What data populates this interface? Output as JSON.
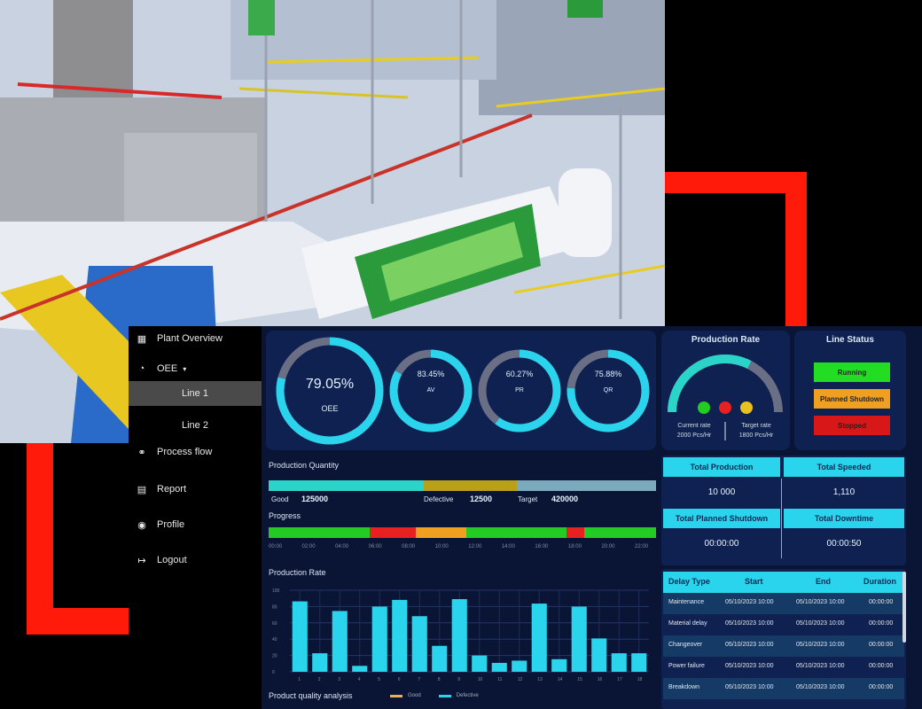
{
  "sidebar": {
    "items": [
      {
        "label": "Plant Overview",
        "icon": "factory-icon"
      },
      {
        "label": "OEE",
        "icon": "gauge-icon"
      },
      {
        "label": "Line 1"
      },
      {
        "label": "Line 2"
      },
      {
        "label": "Process flow",
        "icon": "flow-icon"
      },
      {
        "label": "Report",
        "icon": "report-icon"
      },
      {
        "label": "Profile",
        "icon": "profile-icon"
      },
      {
        "label": "Logout",
        "icon": "logout-icon"
      }
    ],
    "active": "Line 1"
  },
  "oee": {
    "main": {
      "value": "79.05%",
      "label": "OEE",
      "fraction": 0.79
    },
    "gauges": [
      {
        "value": "83.45%",
        "label": "AV",
        "fraction": 0.83
      },
      {
        "value": "60.27%",
        "label": "PR",
        "fraction": 0.6
      },
      {
        "value": "75.88%",
        "label": "QR",
        "fraction": 0.76
      }
    ]
  },
  "production_rate_card": {
    "title": "Production Rate",
    "current_label": "Current rate",
    "current_value": "2000 Pcs/Hr",
    "target_label": "Target rate",
    "target_value": "1800 Pcs/Hr",
    "level": 0.65,
    "lights": [
      "#22cc22",
      "#e82020",
      "#e8c020"
    ]
  },
  "line_status": {
    "title": "Line Status",
    "buttons": [
      {
        "label": "Running",
        "color": "#22dd22"
      },
      {
        "label": "Planned Shutdown",
        "color": "#f0a020"
      },
      {
        "label": "Stopped",
        "color": "#d81818"
      }
    ]
  },
  "production_quantity": {
    "title": "Production Quantity",
    "good_label": "Good",
    "good_value": "125000",
    "defective_label": "Defective",
    "defective_value": "12500",
    "target_label": "Target",
    "target_value": "420000",
    "segments": [
      {
        "fraction": 0.4,
        "color": "#2ad4c8"
      },
      {
        "fraction": 0.24,
        "color": "#b8a018"
      },
      {
        "fraction": 0.36,
        "color": "#7aaabb"
      }
    ]
  },
  "progress": {
    "title": "Progress",
    "segments": [
      {
        "fraction": 0.26,
        "color": "#22cc22"
      },
      {
        "fraction": 0.12,
        "color": "#e82020"
      },
      {
        "fraction": 0.13,
        "color": "#f0a020"
      },
      {
        "fraction": 0.26,
        "color": "#22cc22"
      },
      {
        "fraction": 0.045,
        "color": "#e82020"
      },
      {
        "fraction": 0.185,
        "color": "#22cc22"
      }
    ],
    "ticks": [
      "00:00",
      "02:00",
      "04:00",
      "06:00",
      "08:00",
      "10:00",
      "12:00",
      "14:00",
      "16:00",
      "18:00",
      "20:00",
      "22:00"
    ]
  },
  "kpis": [
    {
      "label": "Total Production",
      "value": "10 000"
    },
    {
      "label": "Total Speeded",
      "value": "1,110"
    },
    {
      "label": "Total Planned Shutdown",
      "value": "00:00:00"
    },
    {
      "label": "Total Downtime",
      "value": "00:00:50"
    }
  ],
  "delay_table": {
    "headers": [
      "Delay Type",
      "Start",
      "End",
      "Duration"
    ],
    "rows": [
      [
        "Maintenance",
        "05/10/2023 10:00",
        "05/10/2023 10:00",
        "00:00:00"
      ],
      [
        "Material delay",
        "05/10/2023 10:00",
        "05/10/2023 10:00",
        "00:00:00"
      ],
      [
        "Changeover",
        "05/10/2023 10:00",
        "05/10/2023 10:00",
        "00:00:00"
      ],
      [
        "Power failure",
        "05/10/2023 10:00",
        "05/10/2023 10:00",
        "00:00:00"
      ],
      [
        "Breakdown",
        "05/10/2023 10:00",
        "05/10/2023 10:00",
        "00:00:00"
      ]
    ]
  },
  "chart_title": "Production Rate",
  "chart_data": {
    "type": "bar",
    "categories": [
      "1",
      "2",
      "3",
      "4",
      "5",
      "6",
      "7",
      "8",
      "9",
      "10",
      "11",
      "12",
      "13",
      "14",
      "15",
      "16",
      "17",
      "18"
    ],
    "values": [
      95,
      25,
      82,
      8,
      88,
      97,
      75,
      35,
      98,
      22,
      12,
      15,
      92,
      17,
      88,
      45,
      25,
      25
    ],
    "ylim": [
      0,
      110
    ],
    "ytick_labels": [
      "100",
      "80",
      "60",
      "40",
      "20",
      "0"
    ],
    "bar_color": "#2ad4ec",
    "grid": true
  },
  "quality": {
    "title": "Product quality analysis",
    "legend": [
      "Good",
      "Defective"
    ],
    "legend_colors": [
      "#e8b050",
      "#2ad4ec"
    ]
  }
}
